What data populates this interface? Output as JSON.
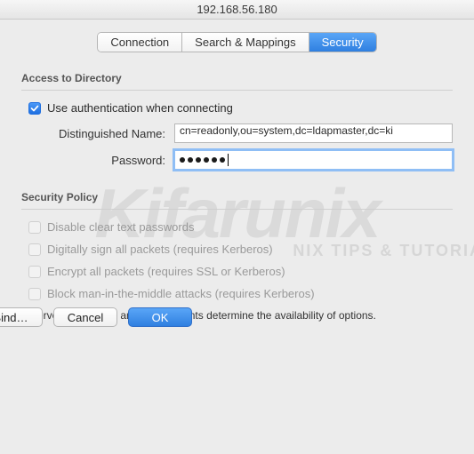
{
  "window": {
    "title": "192.168.56.180"
  },
  "tabs": {
    "connection": "Connection",
    "search": "Search & Mappings",
    "security": "Security"
  },
  "access": {
    "heading": "Access to Directory",
    "use_auth_label": "Use authentication when connecting",
    "dn_label": "Distinguished Name:",
    "dn_value": "cn=readonly,ou=system,dc=ldapmaster,dc=ki",
    "pw_label": "Password:",
    "pw_masked_count": 6
  },
  "policy": {
    "heading": "Security Policy",
    "opt1": "Disable clear text passwords",
    "opt2": "Digitally sign all packets (requires Kerberos)",
    "opt3": "Encrypt all packets (requires SSL or Kerberos)",
    "opt4": "Block man-in-the-middle attacks (requires Kerberos)",
    "hint": "Server capabilities and requirements determine the availability of options."
  },
  "buttons": {
    "bind": "Bind…",
    "cancel": "Cancel",
    "ok": "OK"
  },
  "watermark": {
    "big": "Kifarunix",
    "sub": "NIX TIPS & TUTORIA"
  }
}
